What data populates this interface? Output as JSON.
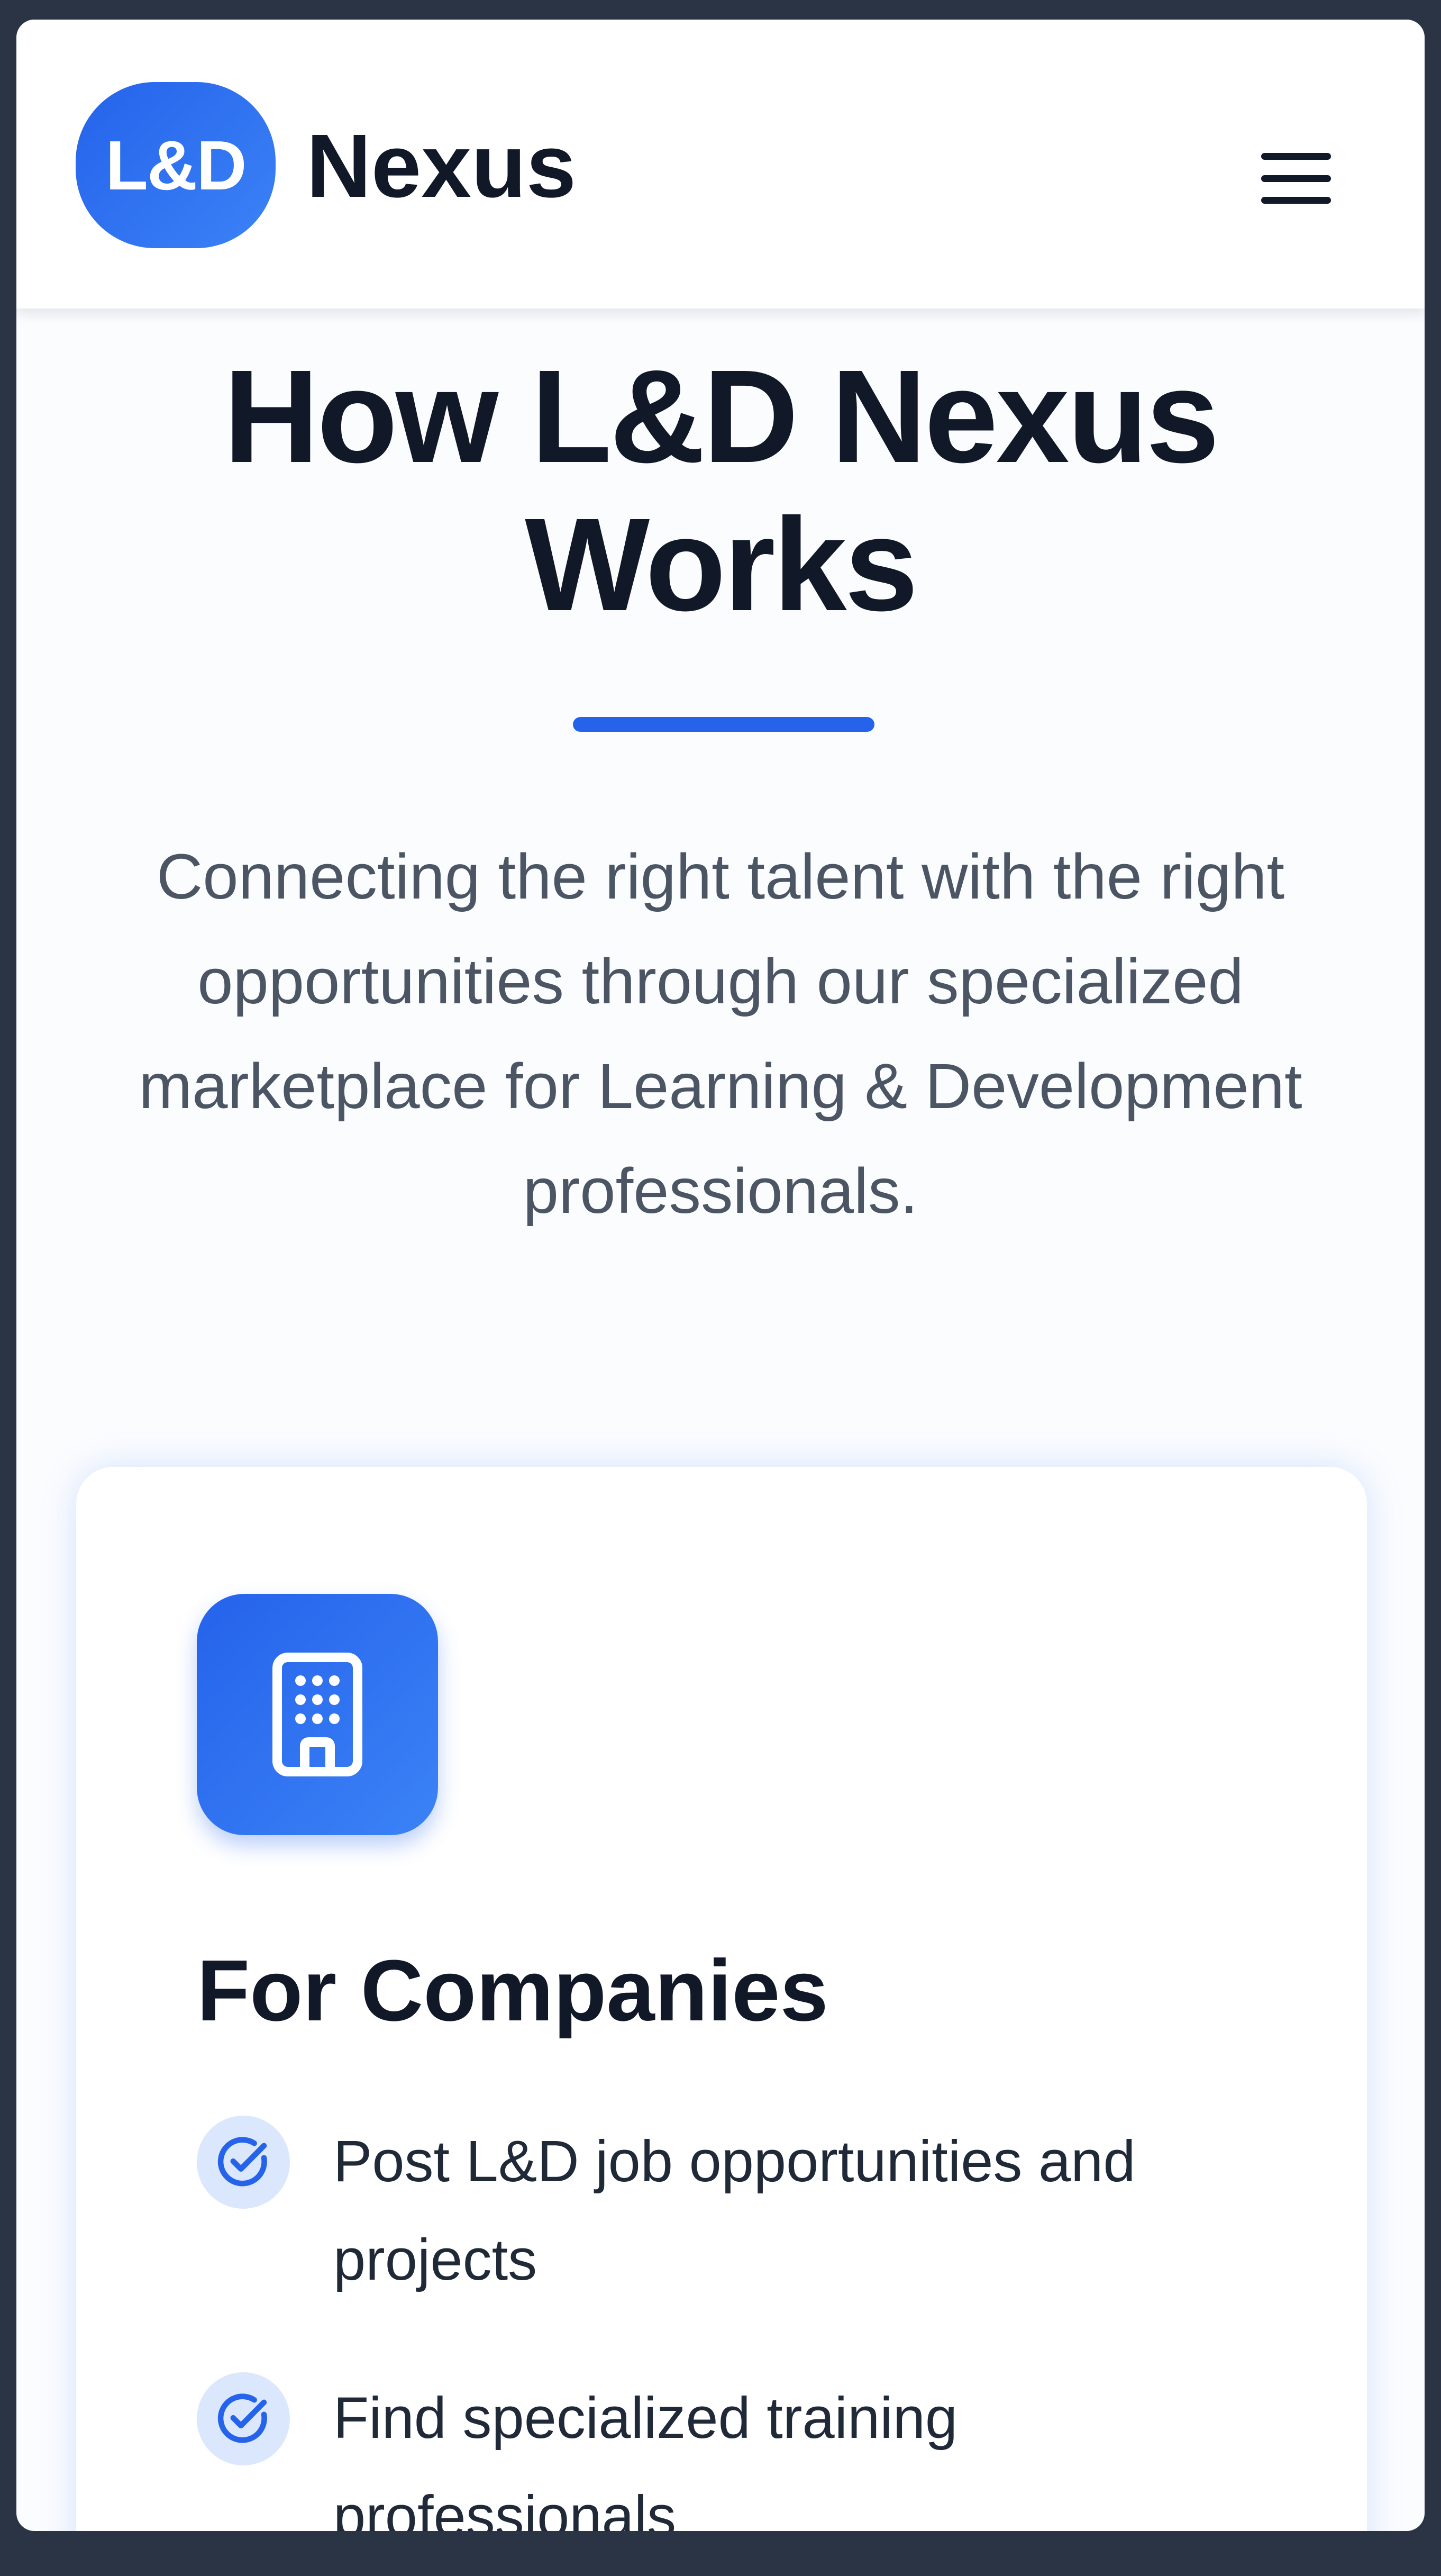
{
  "header": {
    "logo_text": "L&D",
    "brand_name": "Nexus",
    "menu_icon": "hamburger-menu-icon"
  },
  "hero": {
    "title": "How L&D Nexus Works",
    "subtitle": "Connecting the right talent with the right opportunities through our specialized marketplace for Learning & Development professionals."
  },
  "card": {
    "icon": "building-icon",
    "title": "For Companies",
    "features": [
      {
        "icon": "check-circle-icon",
        "text": "Post L&D job opportunities and projects"
      },
      {
        "icon": "check-circle-icon",
        "text": "Find specialized training professionals"
      }
    ]
  },
  "colors": {
    "accent": "#2563eb",
    "accent_light": "#3b82f6",
    "heading": "#111827",
    "body_text": "#4b5563",
    "check_bg": "#dbe7fc",
    "frame": "#2b3444"
  }
}
